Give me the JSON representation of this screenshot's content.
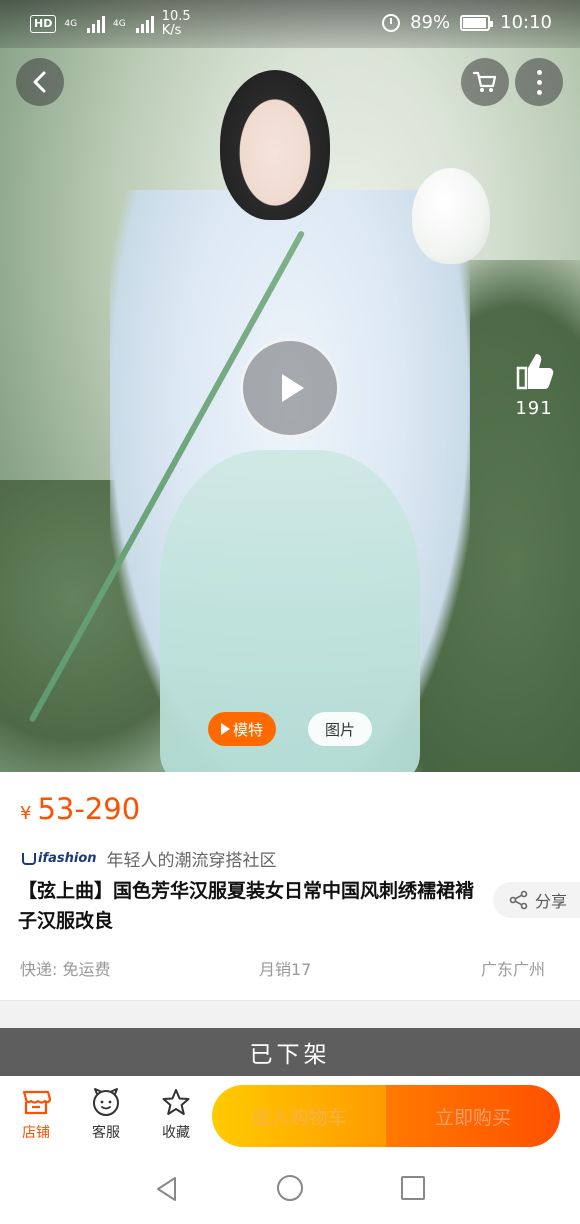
{
  "status_bar": {
    "hd": "HD",
    "net1": "4G",
    "net2": "4G",
    "speed_value": "10.5",
    "speed_unit": "K/s",
    "battery": "89%",
    "time": "10:10"
  },
  "hero": {
    "likes": "191",
    "tab_model": "模特",
    "tab_photo": "图片"
  },
  "product": {
    "currency": "¥",
    "price": "53-290",
    "brand_logo": "ifashion",
    "brand_slogan": "年轻人的潮流穿搭社区",
    "title": "【弦上曲】国色芳华汉服夏装女日常中国风刺绣襦裙褙子汉服改良",
    "share_label": "分享",
    "shipping": "快递: 免运费",
    "monthly_sales": "月销17",
    "location": "广东广州"
  },
  "status_banner": "已下架",
  "action_bar": {
    "shop": "店铺",
    "service": "客服",
    "favorite": "收藏",
    "add_to_cart": "加入购物车",
    "buy_now": "立即购买"
  },
  "colors": {
    "accent": "#ff5000",
    "cart_gradient_start": "#ffcb00",
    "offshelf_bg": "#5e5e5e"
  }
}
